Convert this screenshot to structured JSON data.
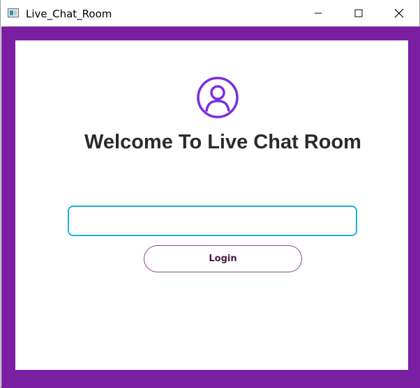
{
  "window": {
    "title": "Live_Chat_Room",
    "frame_color": "#7b1fa2"
  },
  "main": {
    "heading": "Welcome To Live Chat Room",
    "avatar_icon": "user-circle-icon",
    "avatar_color": "#7b2ee0",
    "input": {
      "value": "",
      "placeholder": ""
    },
    "login_label": "Login"
  },
  "controls": {
    "minimize_icon": "minimize-icon",
    "maximize_icon": "maximize-icon",
    "close_icon": "close-icon"
  }
}
